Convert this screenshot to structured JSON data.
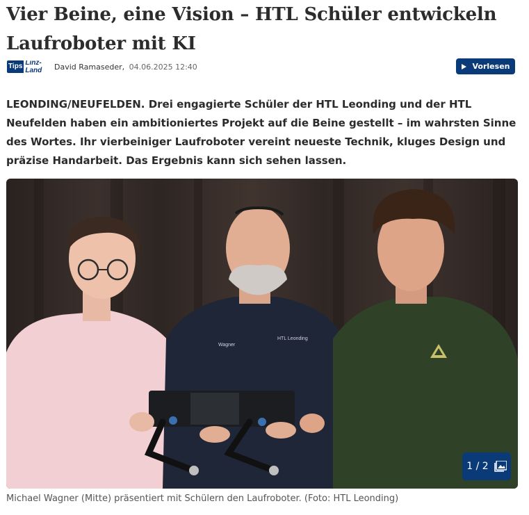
{
  "article": {
    "headline": "Vier Beine, eine Vision – HTL Schüler entwickeln Laufroboter mit KI",
    "source_logo": {
      "tips": "Tips",
      "region": "Linz-Land"
    },
    "author": "David Ramaseder,",
    "date": "04.06.2025 12:40",
    "read_aloud_label": "Vorlesen",
    "lead": "LEONDING/NEUFELDEN. Drei engagierte Schüler der HTL Leonding und der HTL Neufelden haben ein ambitioniertes Projekt auf die Beine gestellt – im wahrsten Sinne des Wortes. Ihr vierbeiniger Laufroboter vereint neueste Technik, kluges Design und präzise Handarbeit. Das Ergebnis kann sich sehen lassen.",
    "image": {
      "counter": "1 / 2",
      "shirt_text_left": "Wagner",
      "shirt_text_right": "HTL Leonding",
      "caption": "Michael Wagner (Mitte) präsentiert mit Schülern den Laufroboter. (Foto: HTL Leonding)"
    }
  },
  "icons": {
    "play": "play-icon",
    "gallery": "gallery-icon"
  },
  "colors": {
    "brand": "#0a3a78",
    "headline": "#2c2c2c",
    "caption": "#555555"
  }
}
